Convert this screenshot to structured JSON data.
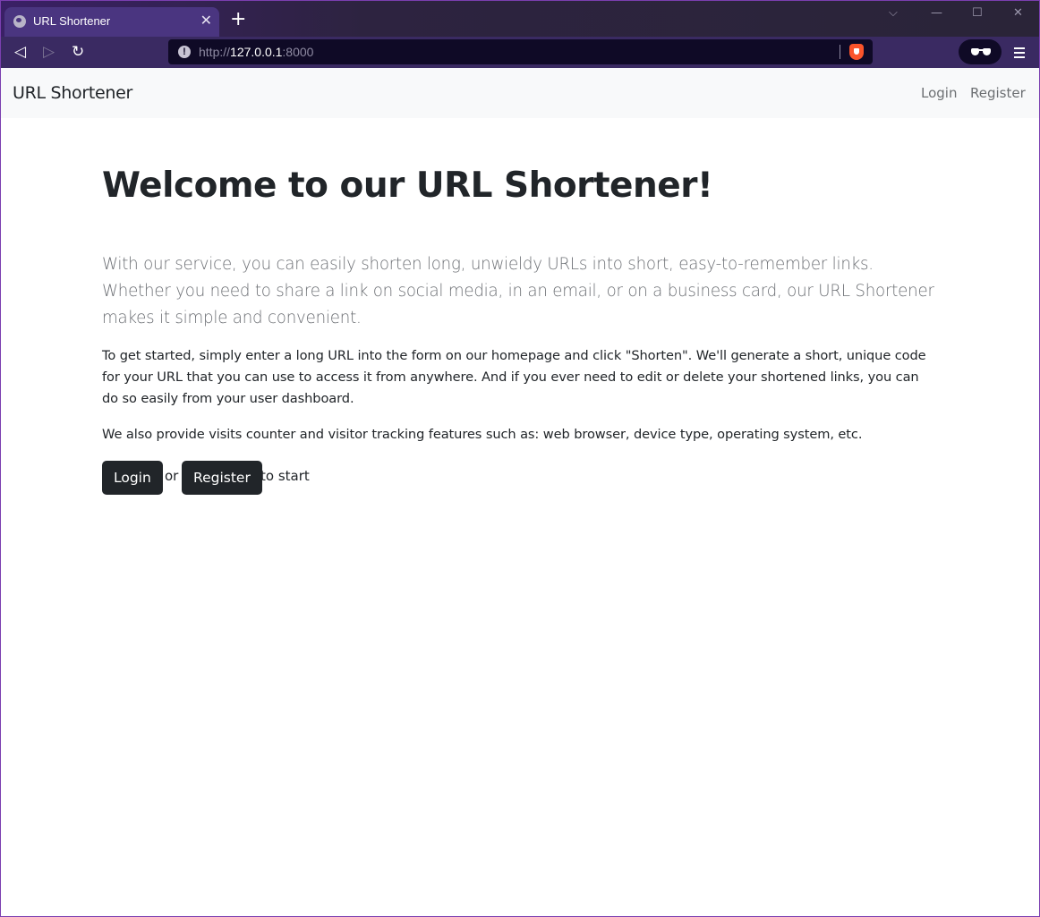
{
  "browser": {
    "tab_title": "URL Shortener",
    "tab_close": "✕",
    "new_tab": "+",
    "window_controls": {
      "dropdown": "⌵",
      "minimize": "—",
      "maximize": "☐",
      "close": "✕"
    },
    "nav": {
      "back": "◁",
      "forward": "▷",
      "reload": "↻"
    },
    "url_scheme": "http://",
    "url_host": "127.0.0.1",
    "url_port": ":8000",
    "info_icon": "!"
  },
  "navbar": {
    "brand": "URL Shortener",
    "login": "Login",
    "register": "Register"
  },
  "main": {
    "title": "Welcome to our URL Shortener!",
    "lead": "With our service, you can easily shorten long, unwieldy URLs into short, easy-to-remember links. Whether you need to share a link on social media, in an email, or on a business card, our URL Shortener makes it simple and convenient.",
    "paragraph1": "To get started, simply enter a long URL into the form on our homepage and click \"Shorten\". We'll generate a short, unique code for your URL that you can use to access it from anywhere. And if you ever need to edit or delete your shortened links, you can do so easily from your user dashboard.",
    "paragraph2": "We also provide visits counter and visitor tracking features such as: web browser, device type, operating system, etc.",
    "cta": {
      "login_label": "Login",
      "or_text": "or",
      "register_label": "Register",
      "suffix_text": "to start"
    }
  },
  "colors": {
    "button_dark": "#212529",
    "navbar_bg": "#f8f9fa",
    "muted_text": "#6c757d",
    "brave_orange": "#fb542b"
  }
}
